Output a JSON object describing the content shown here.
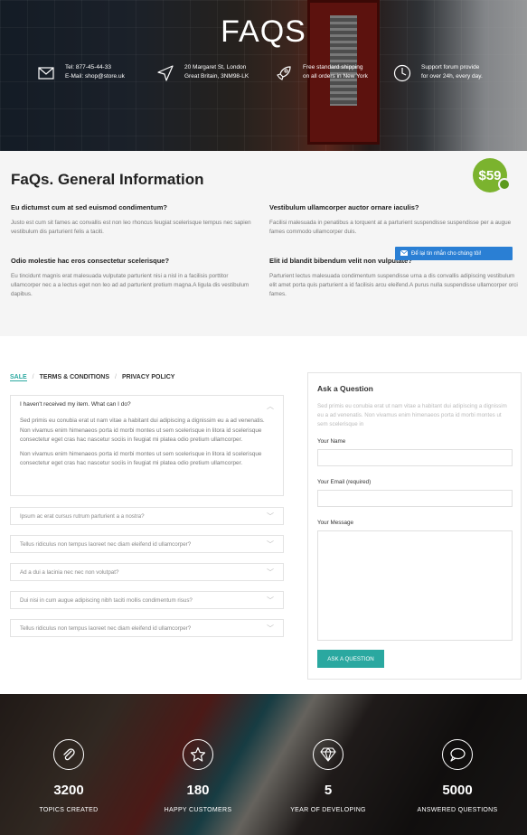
{
  "hero": {
    "title": "FAQS",
    "info": [
      {
        "icon": "envelope-icon",
        "line1": "Tel: 877-45-44-33",
        "line2": "E-Mail: shop@store.uk"
      },
      {
        "icon": "location-arrow-icon",
        "line1": "20 Margaret St, London",
        "line2": "Great Britain, 3NM98-LK"
      },
      {
        "icon": "rocket-icon",
        "line1": "Free standard shipping",
        "line2": "on all orders in New York"
      },
      {
        "icon": "clock-icon",
        "line1": "Support forum provide",
        "line2": "for over 24h, every day."
      }
    ]
  },
  "general": {
    "title": "FaQs. General Information",
    "price": "$59",
    "questions": [
      {
        "q": "Eu dictumst cum at sed euismod condimentum?",
        "a": "Justo est cum sit fames ac convallis est non leo rhoncus feugiat scelerisque tempus nec sapien vestibulum dis parturient felis a taciti."
      },
      {
        "q": "Vestibulum ullamcorper auctor ornare iaculis?",
        "a": "Facilisi malesuada in penatibus a torquent at a parturient suspendisse suspendisse per a augue fames commodo ullamcorper duis."
      },
      {
        "q": "Odio molestie hac eros consectetur scelerisque?",
        "a": "Eu tincidunt magnis erat malesuada vulputate parturient nisi a nisl in a facilisis porttitor ullamcorper nec a a lectus eget non leo ad ad parturient pretium magna.A ligula dis vestibulum dapibus."
      },
      {
        "q": "Elit id blandit bibendum velit non vulputate?",
        "a": "Parturient lectus malesuada condimentum suspendisse urna a dis convallis adipiscing vestibulum elit amet porta quis parturient a id facilisis arcu eleifend.A purus nulla suspendisse ullamcorper orci fames."
      }
    ],
    "chat_label": "Để lại tin nhắn cho chúng tôi!"
  },
  "tabs": [
    "SALE",
    "TERMS & CONDITIONS",
    "PRIVACY POLICY"
  ],
  "accordion": {
    "open": {
      "title": "I haven't received my item. What can I do?",
      "p1": "Sed primis eu conubia erat ut nam vitae a habitant dui adipiscing a dignissim eu a ad venenatis. Non vivamus enim himenaeos porta id morbi montes ut sem scelerisque in litora id scelerisque consectetur eget cras hac nascetur sociis in feugiat mi platea odio pretium ullamcorper.",
      "p2": "Non vivamus enim himenaeos porta id morbi montes ut sem scelerisque in litora id scelerisque consectetur eget cras hac nascetur sociis in feugiat mi platea odio pretium ullamcorper."
    },
    "items": [
      "Ipsum ac erat cursus rutrum parturient a a nostra?",
      "Tellus ridiculus non tempus laoreet nec diam eleifend id ullamcorper?",
      "Ad a dui a lacinia nec nec non volutpat?",
      "Dui nisi in cum augue adipiscing nibh taciti mollis condimentum risus?",
      "Tellus ridiculus non tempus laoreet nec diam eleifend id ullamcorper?"
    ]
  },
  "form": {
    "title": "Ask a Question",
    "desc": "Sed primis eu conubia erat ut nam vitae a habitant dui adipiscing a dignissim eu a ad venenatis. Non vivamus enim himenaeos porta id morbi montes ut sem scelerisque in",
    "name_label": "Your Name",
    "email_label": "Your Email (required)",
    "message_label": "Your Message",
    "button": "ASK A QUESTION"
  },
  "stats": [
    {
      "icon": "paperclip-icon",
      "value": "3200",
      "label": "TOPICS CREATED"
    },
    {
      "icon": "star-icon",
      "value": "180",
      "label": "HAPPY CUSTOMERS"
    },
    {
      "icon": "diamond-icon",
      "value": "5",
      "label": "YEAR OF DEVELOPING"
    },
    {
      "icon": "speech-bubble-icon",
      "value": "5000",
      "label": "ANSWERED QUESTIONS"
    }
  ],
  "colors": {
    "accent": "#2aa8a0",
    "price_badge": "#7bb32e",
    "chat": "#2a7fd4"
  }
}
